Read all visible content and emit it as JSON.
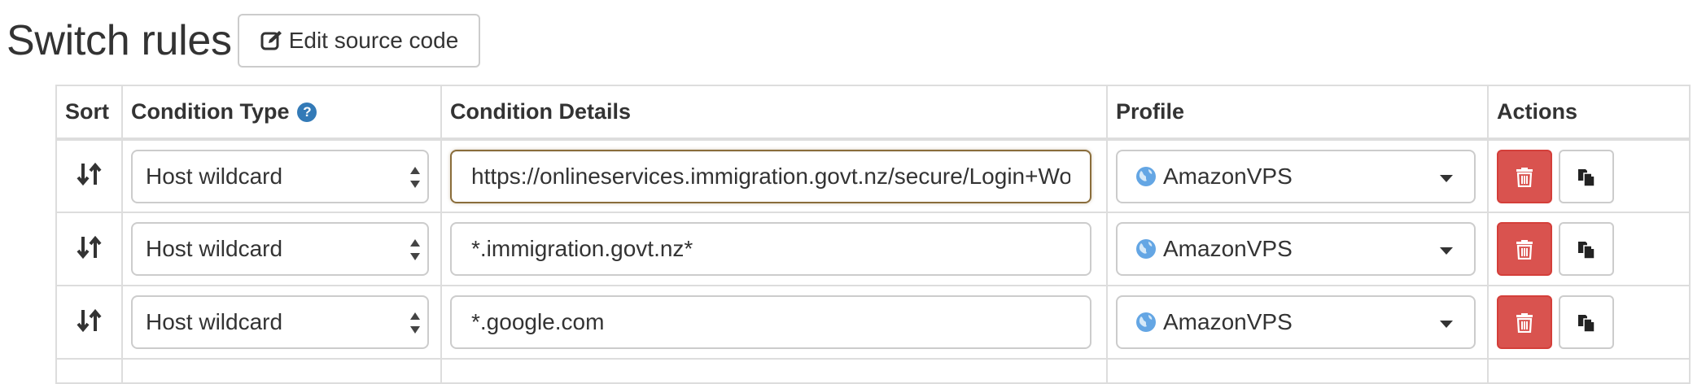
{
  "header": {
    "title": "Switch rules",
    "edit_source_label": "Edit source code",
    "edit_icon": "edit-icon"
  },
  "table": {
    "columns": {
      "sort": "Sort",
      "condition_type": "Condition Type",
      "condition_details": "Condition Details",
      "profile": "Profile",
      "actions": "Actions"
    },
    "help_icon": "question-circle-icon",
    "rows": [
      {
        "condition_type": "Host wildcard",
        "condition_details": "https://onlineservices.immigration.govt.nz/secure/Login+Working+Holiday.htm",
        "profile": "AmazonVPS",
        "focused": true
      },
      {
        "condition_type": "Host wildcard",
        "condition_details": "*.immigration.govt.nz*",
        "profile": "AmazonVPS",
        "focused": false
      },
      {
        "condition_type": "Host wildcard",
        "condition_details": "*.google.com",
        "profile": "AmazonVPS",
        "focused": false
      }
    ]
  },
  "colors": {
    "text": "#333333",
    "border": "#dddddd",
    "danger": "#d9534f",
    "help": "#337ab7",
    "focus_border": "#8a6d3b",
    "globe": "#64a6e4"
  }
}
